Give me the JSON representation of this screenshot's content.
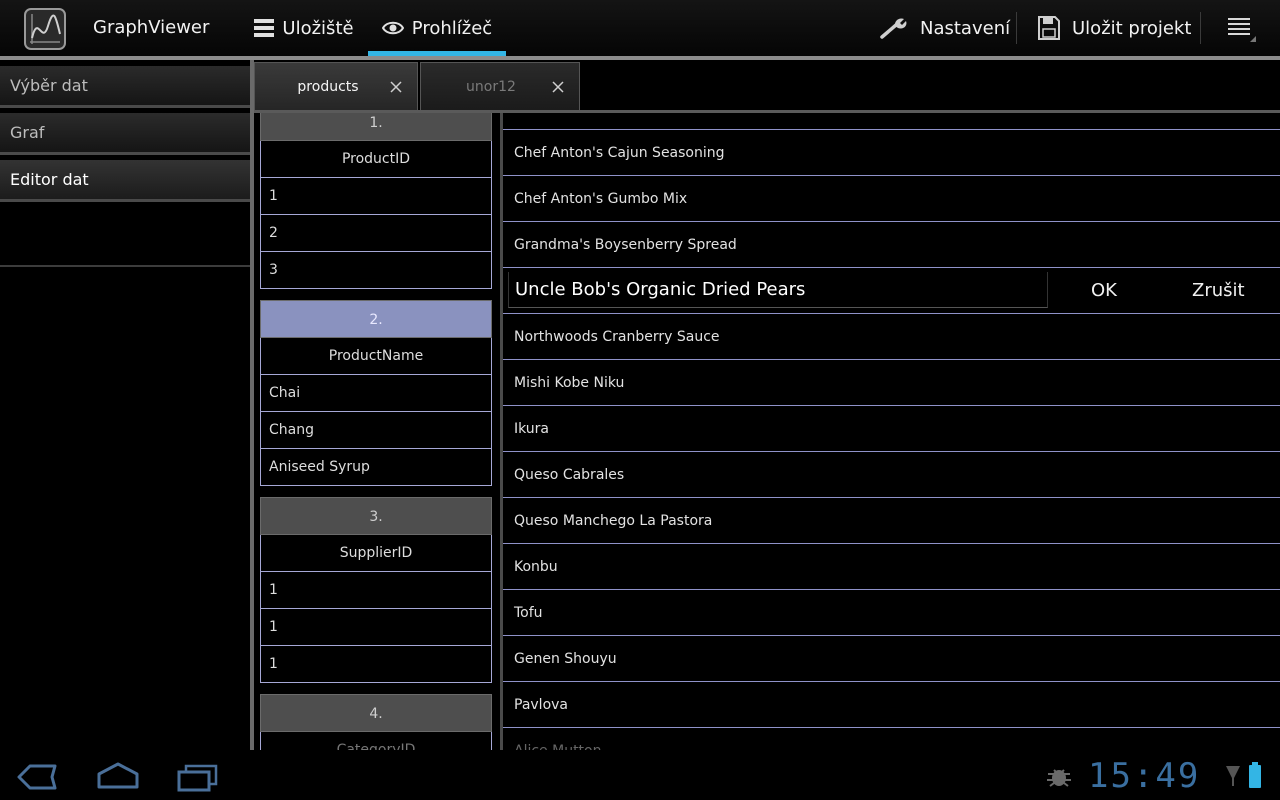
{
  "app": {
    "title": "GraphViewer",
    "icon": "graph-app-icon"
  },
  "nav_tabs": [
    {
      "label": "Uložiště",
      "icon": "list-icon",
      "active": false
    },
    {
      "label": "Prohlížeč",
      "icon": "eye-icon",
      "active": true
    }
  ],
  "actions": {
    "settings_label": "Nastavení",
    "save_label": "Uložit projekt"
  },
  "sidebar": {
    "items": [
      {
        "label": "Výběr dat",
        "active": false
      },
      {
        "label": "Graf",
        "active": false
      },
      {
        "label": "Editor dat",
        "active": true
      }
    ]
  },
  "doc_tabs": [
    {
      "label": "products",
      "active": true
    },
    {
      "label": "unor12",
      "active": false
    }
  ],
  "columns": [
    {
      "number": "1.",
      "name": "ProductID",
      "values": [
        "1",
        "2",
        "3"
      ],
      "selected": false
    },
    {
      "number": "2.",
      "name": "ProductName",
      "values": [
        "Chai",
        "Chang",
        "Aniseed Syrup"
      ],
      "selected": true
    },
    {
      "number": "3.",
      "name": "SupplierID",
      "values": [
        "1",
        "1",
        "1"
      ],
      "selected": false
    },
    {
      "number": "4.",
      "name": "CategoryID",
      "values": [],
      "selected": false
    }
  ],
  "values_before": [
    "Chef Anton's Cajun Seasoning",
    "Chef Anton's Gumbo Mix",
    "Grandma's Boysenberry Spread"
  ],
  "edit": {
    "value": "Uncle Bob's Organic Dried Pears",
    "ok_label": "OK",
    "cancel_label": "Zrušit"
  },
  "values_after": [
    "Northwoods Cranberry Sauce",
    "Mishi Kobe Niku",
    "Ikura",
    "Queso Cabrales",
    "Queso Manchego La Pastora",
    "Konbu",
    "Tofu",
    "Genen Shouyu",
    "Pavlova",
    "Alice Mutton"
  ],
  "status": {
    "clock": "15:49"
  },
  "colors": {
    "accent": "#33b5e5",
    "row_divider": "#8f92c9",
    "selected_column": "#8a92bf"
  }
}
